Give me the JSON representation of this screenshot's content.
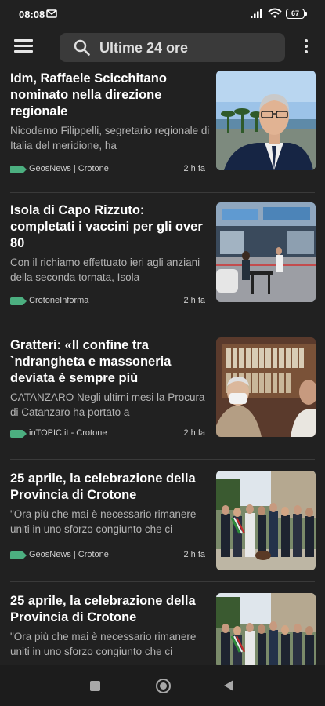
{
  "status_bar": {
    "time": "08:08",
    "battery": "67"
  },
  "search": {
    "text": "Ultime 24 ore"
  },
  "articles": [
    {
      "title": "Idm, Raffaele Scicchitano nominato nella direzione regionale",
      "snippet": "Nicodemo Filippelli, segretario regionale di Italia del meridione, ha",
      "source": "GeosNews | Crotone",
      "age": "2 h fa"
    },
    {
      "title": "Isola di Capo Rizzuto: completati i vaccini per gli over 80",
      "snippet": "Con il richiamo effettuato ieri agli anziani della seconda tornata, Isola",
      "source": "CrotoneInforma",
      "age": "2 h fa"
    },
    {
      "title": "Gratteri: «Il confine tra `ndrangheta e massoneria deviata è sempre più",
      "snippet": "CATANZARO Negli ultimi mesi la Procura di Catanzaro ha portato a",
      "source": "inTOPIC.it - Crotone",
      "age": "2 h fa"
    },
    {
      "title": "25 aprile, la celebrazione della Provincia di Crotone",
      "snippet": "\"Ora più che mai è necessario rimanere uniti in uno sforzo congiunto che ci",
      "source": "GeosNews | Crotone",
      "age": "2 h fa"
    },
    {
      "title": "25 aprile, la celebrazione della Provincia di Crotone",
      "snippet": "\"Ora più che mai è necessario rimanere uniti in uno sforzo congiunto che ci",
      "source": "",
      "age": ""
    }
  ],
  "colors": {
    "background": "#212121",
    "source_tag": "#4caf80",
    "search_bg": "#3a3a3a"
  },
  "icons": [
    "menu-icon",
    "search-icon",
    "more-vert-icon",
    "recents-icon",
    "home-icon",
    "back-icon"
  ]
}
